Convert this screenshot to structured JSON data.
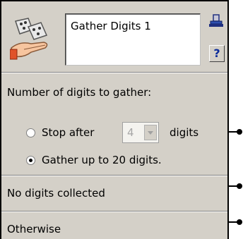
{
  "node": {
    "title": "Gather Digits 1",
    "help_label": "?"
  },
  "section_digits": {
    "heading": "Number of digits to gather:",
    "option_stop_prefix": "Stop after",
    "option_stop_value": "4",
    "option_stop_suffix": "digits",
    "option_gather": "Gather up to 20 digits.",
    "selected": "gather"
  },
  "branches": {
    "no_digits": "No digits collected",
    "otherwise": "Otherwise"
  },
  "icons": {
    "app": "dice-hand-icon",
    "lock": "lock-icon",
    "connector": "connector-dot-icon"
  }
}
